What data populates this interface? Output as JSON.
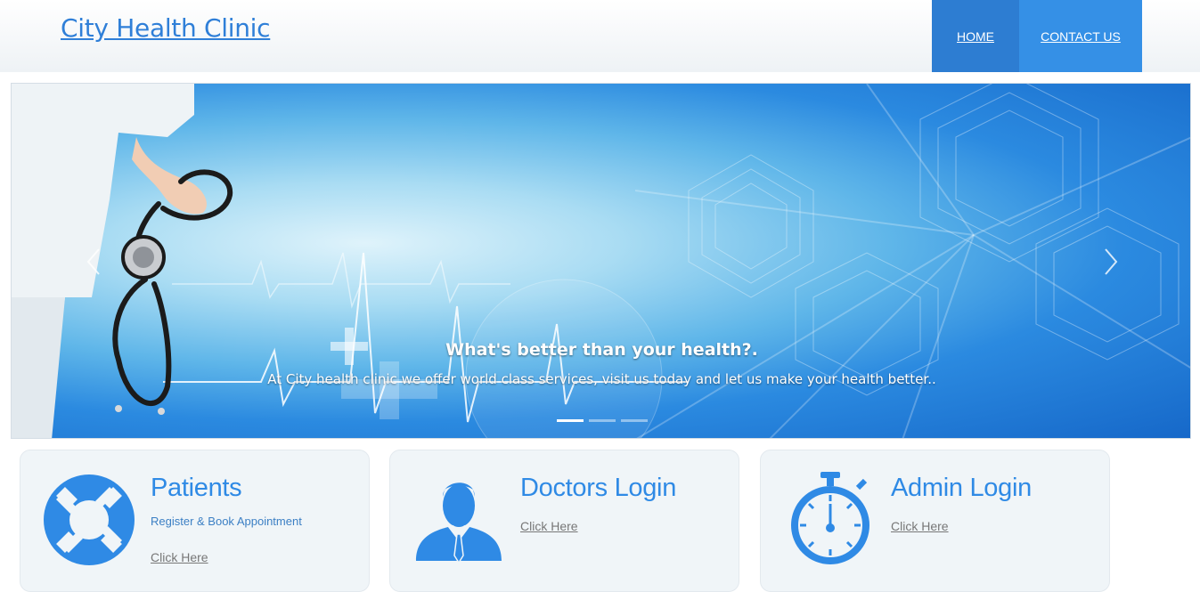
{
  "header": {
    "logo": "City Health Clinic",
    "nav": [
      {
        "label": "HOME"
      },
      {
        "label": "CONTACT US"
      }
    ]
  },
  "carousel": {
    "title": "What's better than your health?.",
    "text": "At City health clinic we offer world class services, visit us today and let us make your health better..",
    "slides_count": 3,
    "active_slide": 1
  },
  "cards": [
    {
      "icon": "lifebuoy-icon",
      "title": "Patients",
      "subtitle": "Register & Book Appointment",
      "link": "Click Here"
    },
    {
      "icon": "doctor-icon",
      "title": "Doctors Login",
      "link": "Click Here"
    },
    {
      "icon": "stopwatch-icon",
      "title": "Admin Login",
      "link": "Click Here"
    }
  ],
  "colors": {
    "accent": "#2f8ae5",
    "nav_home": "#2d7dd2",
    "nav_contact": "#3590e6"
  }
}
